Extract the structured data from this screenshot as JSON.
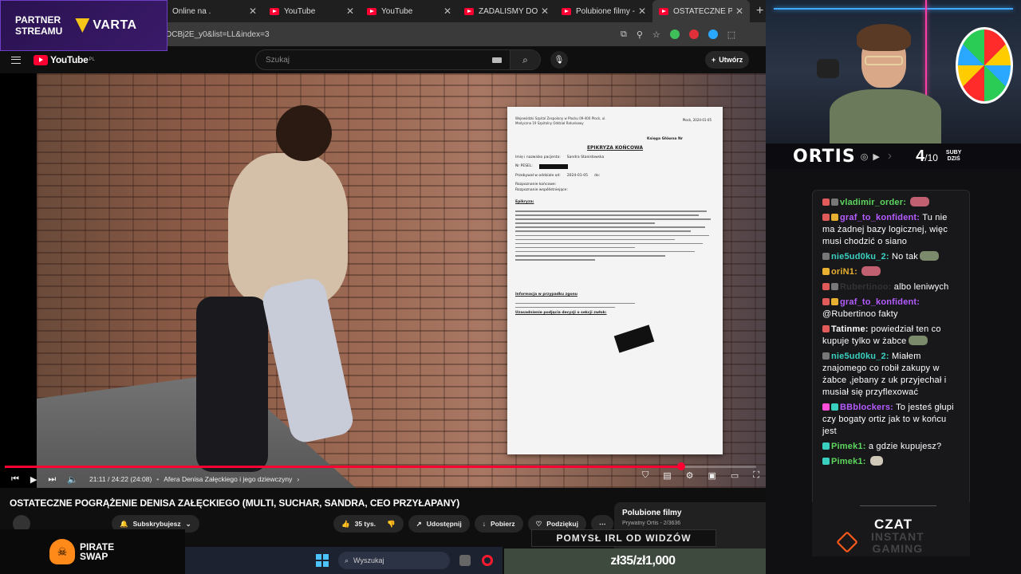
{
  "browser": {
    "tabs": [
      {
        "title": "Online na ."
      },
      {
        "title": "YouTube"
      },
      {
        "title": "YouTube"
      },
      {
        "title": "ZADALIŚMY DOROSŁ"
      },
      {
        "title": "Polubione filmy - You"
      },
      {
        "title": "OSTATECZNE POGRĄ"
      }
    ],
    "url": "DCBj2E_y0&list=LL&index=3"
  },
  "youtube": {
    "logo_text": "YouTube",
    "logo_region": "PL",
    "search_placeholder": "Szukaj",
    "create_label": "Utwórz"
  },
  "document": {
    "hospital": "Wojewódzki Szpital Zespolony w Płocku 09-400 Płock, ul. Medyczna 19 Szpitalny Oddział Ratunkowy",
    "date": "Płock, 2024-01-05",
    "book": "Księga Główna Nr",
    "heading": "EPIKRYZA KOŃCOWA",
    "patient_label": "Imię i nazwisko pacjenta:",
    "patient_name": "Sandra Stanisławska",
    "pesel_label": "Nr PESEL:",
    "stay_label": "Przebywał w oddziale od:",
    "stay_from": "2024-01-05",
    "stay_to": "do:",
    "diag_label": "Rozpoznanie końcowe:",
    "codiag_label": "Rozpoznanie współistniejące:",
    "epikryza_label": "Epikryza:",
    "death_info": "Informacja w przypadku zgonu",
    "signature_label": "Uzasadnienie podjęcia decyzji o sekcji zwłok:"
  },
  "player": {
    "progress": 0.9,
    "time": "21:11 / 24:22 (24:08)",
    "chapter": "Afera Denisa Załęckiego i jego dziewczyny"
  },
  "video": {
    "title": "OSTATECZNE POGRĄŻENIE DENISA ZAŁĘCKIEGO (MULTI, SUCHAR, SANDRA, CEO PRZYŁAPANY)",
    "subscribe_label": "Subskrybujesz",
    "likes": "35 tys.",
    "share_label": "Udostępnij",
    "download_label": "Pobierz",
    "thanks_label": "Podziękuj"
  },
  "playlist": {
    "title": "Polubione filmy",
    "meta": "Prywatny  Ortis  -  2/3636"
  },
  "overlays": {
    "partner_line1": "PARTNER",
    "partner_line2": "STREAMU",
    "sponsor": "VARTA",
    "pirate_line1": "PIRATE",
    "pirate_line2": "SWAP",
    "idea": "POMYSŁ IRL OD WIDZÓW",
    "goal": "zł35/zł1,000",
    "taskbar_search": "Wyszukaj"
  },
  "stream": {
    "name": "ORTIS",
    "subs_count": "4",
    "subs_goal": "/10",
    "subs_line1": "SUBY",
    "subs_line2": "DZIŚ"
  },
  "chat": {
    "messages": [
      {
        "user": "vladimir_order:",
        "text": "",
        "color": "#5cd65c"
      },
      {
        "user": "graf_to_konfident:",
        "text": "Tu nie ma żadnej bazy logicznej, więc musi chodzić o siano",
        "color": "#b45cff"
      },
      {
        "user": "nie5ud0ku_2:",
        "text": "No tak",
        "color": "#3ad0c0"
      },
      {
        "user": "oriN1:",
        "text": "",
        "color": "#e8b030"
      },
      {
        "user": "Rubertinoo:",
        "text": "albo leniwych",
        "color": "#333333"
      },
      {
        "user": "graf_to_konfident:",
        "text": "@Rubertinoo fakty",
        "color": "#b45cff"
      },
      {
        "user": "Tatinme:",
        "text": "powiedział ten co kupuje tylko w żabce",
        "color": "#ffffff"
      },
      {
        "user": "nie5ud0ku_2:",
        "text": "Miałem znajomego co robił zakupy w żabce  ,jebany z uk przyjechał i musiał się przyflexować",
        "color": "#3ad0c0"
      },
      {
        "user": "BBblockers:",
        "text": "To jesteś głupi czy bogaty ortiz jak to w końcu jest",
        "color": "#b45cff"
      },
      {
        "user": "Pimek1:",
        "text": "a gdzie kupujesz?",
        "color": "#5cd65c"
      },
      {
        "user": "Pimek1:",
        "text": "",
        "color": "#5cd65c"
      }
    ],
    "footer_title": "CZAT",
    "footer_line1": "INSTANT",
    "footer_line2": "GAMING"
  },
  "colors": {
    "accent": "#ff0033",
    "partner_bg": "#2a1250",
    "goal_bg": "#3f4a3f"
  }
}
